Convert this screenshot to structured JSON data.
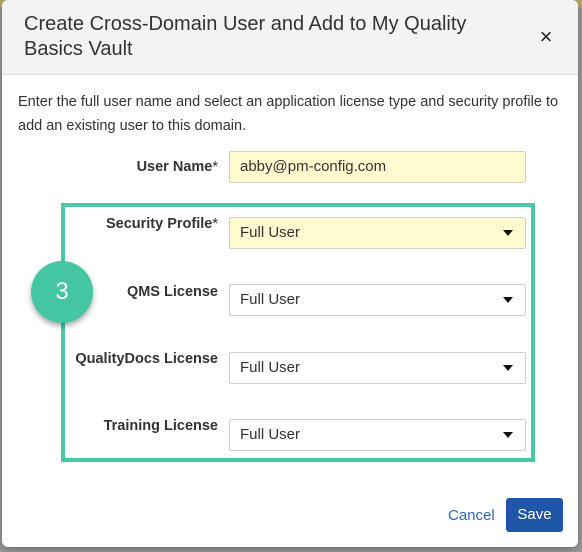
{
  "dialog": {
    "title": "Create Cross-Domain User and Add to My Quality Basics Vault",
    "close_symbol": "×",
    "intro": "Enter the full user name and select an application license type and security profile to add an existing user to this domain."
  },
  "form": {
    "user_name": {
      "label": "User Name",
      "required_mark": "*",
      "value": "abby@pm-config.com"
    },
    "security_profile": {
      "label": "Security Profile",
      "required_mark": "*",
      "value": "Full User"
    },
    "qms_license": {
      "label": "QMS License",
      "value": "Full User"
    },
    "qualitydocs_license": {
      "label": "QualityDocs License",
      "value": "Full User"
    },
    "training_license": {
      "label": "Training License",
      "value": "Full User"
    }
  },
  "annotation": {
    "step_number": "3",
    "accent_color": "#44cca6"
  },
  "footer": {
    "cancel_label": "Cancel",
    "save_label": "Save"
  },
  "colors": {
    "save_button": "#1f57a8",
    "link": "#2b68b8",
    "required_field_bg": "#fffbcf"
  }
}
